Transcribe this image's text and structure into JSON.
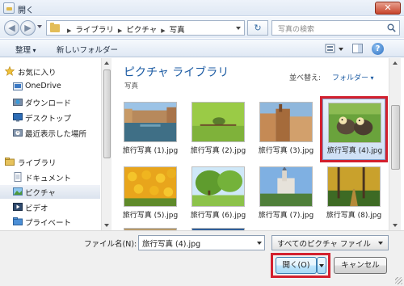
{
  "window": {
    "title": "開く",
    "close_label": "✕"
  },
  "nav": {
    "back_glyph": "◀",
    "forward_glyph": "▶",
    "breadcrumbs": [
      "ライブラリ",
      "ピクチャ",
      "写真"
    ],
    "refresh_glyph": "↻",
    "search_placeholder": "写真の検索"
  },
  "toolbar": {
    "organize_label": "整理",
    "new_folder_label": "新しいフォルダー",
    "help_label": "?"
  },
  "sidebar": {
    "items": [
      {
        "label": "お気に入り",
        "icon": "star-icon",
        "level": 0
      },
      {
        "label": "OneDrive",
        "icon": "onedrive-icon",
        "level": 1
      },
      {
        "label": "ダウンロード",
        "icon": "download-folder-icon",
        "level": 1
      },
      {
        "label": "デスクトップ",
        "icon": "desktop-icon",
        "level": 1
      },
      {
        "label": "最近表示した場所",
        "icon": "recent-places-icon",
        "level": 1
      },
      {
        "label": "ライブラリ",
        "icon": "library-icon",
        "level": 0
      },
      {
        "label": "ドキュメント",
        "icon": "documents-icon",
        "level": 1
      },
      {
        "label": "ピクチャ",
        "icon": "pictures-icon",
        "level": 1,
        "selected": true
      },
      {
        "label": "ビデオ",
        "icon": "videos-icon",
        "level": 1
      },
      {
        "label": "プライベート",
        "icon": "private-folder-icon",
        "level": 1
      }
    ]
  },
  "library": {
    "title": "ピクチャ ライブラリ",
    "subtitle": "写真",
    "arrange_label": "並べ替え:",
    "arrange_value": "フォルダー"
  },
  "files": [
    {
      "name": "旅行写真 (1).jpg",
      "scene": "canal-city"
    },
    {
      "name": "旅行写真 (2).jpg",
      "scene": "green-bird"
    },
    {
      "name": "旅行写真 (3).jpg",
      "scene": "old-town"
    },
    {
      "name": "旅行写真 (4).jpg",
      "scene": "ducklings",
      "selected": true
    },
    {
      "name": "旅行写真 (5).jpg",
      "scene": "tulips"
    },
    {
      "name": "旅行写真 (6).jpg",
      "scene": "green-trees"
    },
    {
      "name": "旅行写真 (7).jpg",
      "scene": "castle"
    },
    {
      "name": "旅行写真 (8).jpg",
      "scene": "autumn-forest"
    },
    {
      "name": "",
      "scene": "partial-1"
    },
    {
      "name": "",
      "scene": "partial-2"
    }
  ],
  "footer": {
    "filename_label": "ファイル名(N):",
    "filename_value": "旅行写真 (4).jpg",
    "filter_value": "すべてのピクチャ ファイル",
    "open_label": "開く(O)",
    "cancel_label": "キャンセル"
  },
  "colors": {
    "highlight": "#d3202e",
    "link_blue": "#1c5ba3"
  }
}
